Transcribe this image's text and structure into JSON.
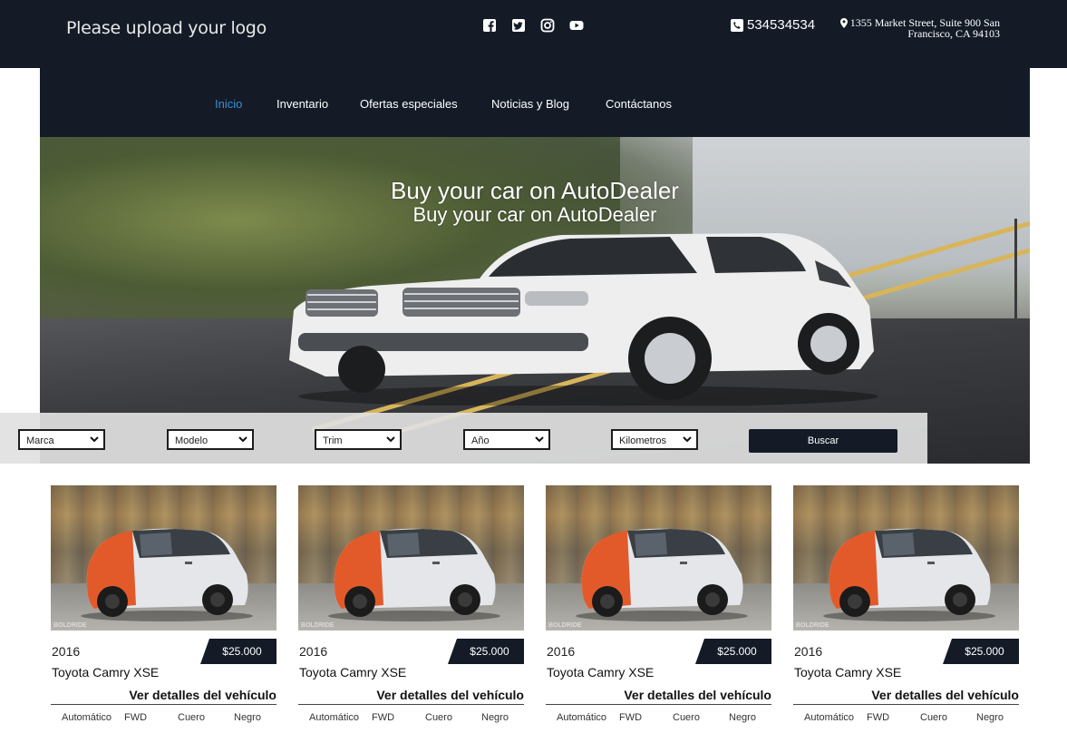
{
  "header": {
    "logo_text": "Please upload your logo",
    "socials": [
      "facebook-icon",
      "twitter-icon",
      "instagram-icon",
      "youtube-icon"
    ],
    "phone": "534534534",
    "address": "1355 Market Street, Suite 900 San Francisco, CA 94103"
  },
  "nav": {
    "items": [
      "Inicio",
      "Inventario",
      "Ofertas especiales",
      "Noticias y Blog",
      "Contáctanos"
    ],
    "active": "Inicio"
  },
  "hero": {
    "title": "Buy your car on AutoDealer",
    "subtitle": "Buy your car on AutoDealer"
  },
  "search": {
    "selects": [
      "Marca",
      "Modelo",
      "Trim",
      "Año",
      "Kilometros"
    ],
    "button": "Buscar"
  },
  "cards": [
    {
      "year": "2016",
      "price": "$25.000",
      "name": "Toyota Camry XSE",
      "link": "Ver detalles del vehículo",
      "specs": [
        "Automático",
        "FWD",
        "Cuero",
        "Negro"
      ]
    },
    {
      "year": "2016",
      "price": "$25.000",
      "name": "Toyota Camry XSE",
      "link": "Ver detalles del vehículo",
      "specs": [
        "Automático",
        "FWD",
        "Cuero",
        "Negro"
      ]
    },
    {
      "year": "2016",
      "price": "$25.000",
      "name": "Toyota Camry XSE",
      "link": "Ver detalles del vehículo",
      "specs": [
        "Automático",
        "FWD",
        "Cuero",
        "Negro"
      ]
    },
    {
      "year": "2016",
      "price": "$25.000",
      "name": "Toyota Camry XSE",
      "link": "Ver detalles del vehículo",
      "specs": [
        "Automático",
        "FWD",
        "Cuero",
        "Negro"
      ]
    }
  ],
  "colors": {
    "header_bg": "#141b27",
    "nav_active": "#3a8fd6",
    "price_bg": "#141b27"
  }
}
